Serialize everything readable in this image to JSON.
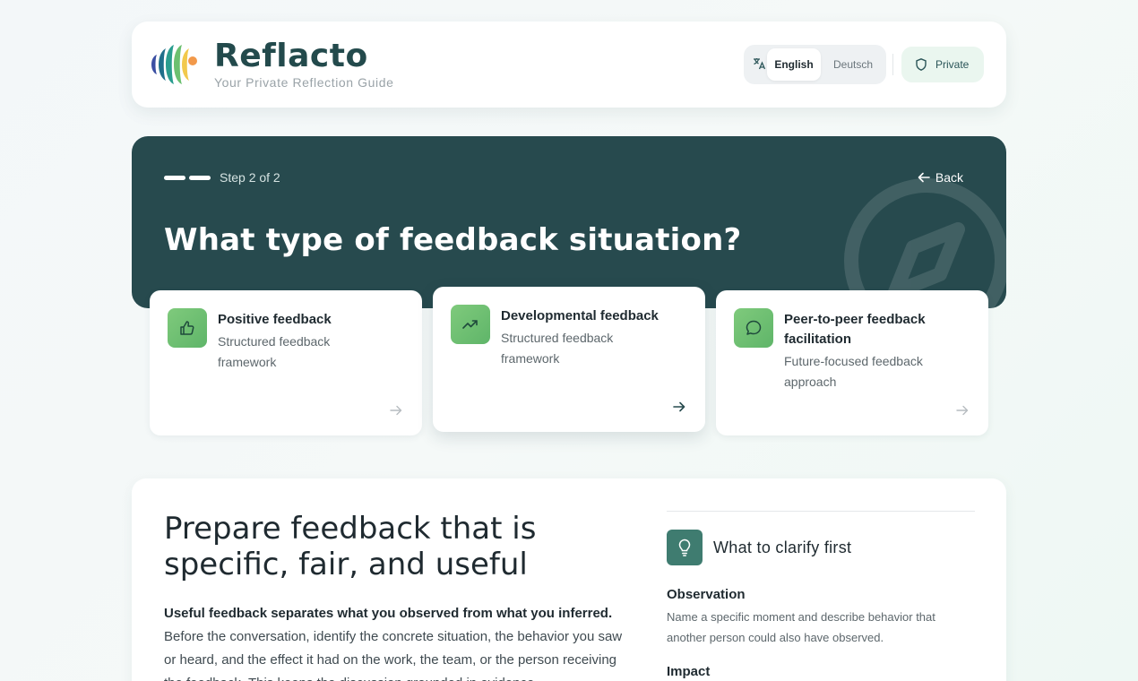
{
  "brand": {
    "name": "Reflacto",
    "tagline": "Your Private Reflection Guide"
  },
  "language": {
    "options": [
      "English",
      "Deutsch"
    ],
    "selected": "English"
  },
  "privacy": {
    "label": "Private"
  },
  "wizard": {
    "step_label": "Step 2 of 2",
    "back_label": "Back",
    "title": "What type of feedback situation?",
    "steps_total": 2,
    "steps_done": 2
  },
  "options": [
    {
      "title": "Positive feedback",
      "description": "Structured feedback framework",
      "icon": "thumbs-up-icon"
    },
    {
      "title": "Developmental feedback",
      "description": "Structured feedback framework",
      "icon": "trending-up-icon"
    },
    {
      "title": "Peer-to-peer feedback facilitation",
      "description": "Future-focused feedback approach",
      "icon": "chat-bubble-icon"
    }
  ],
  "prepare": {
    "title": "Prepare feedback that is specific, fair, and useful",
    "lead_bold": "Useful feedback separates what you observed from what you inferred.",
    "lead_text": "Before the conversation, identify the concrete situation, the behavior you saw or heard, and the effect it had on the work, the team, or the person receiving the feedback. This keeps the discussion grounded in evidence."
  },
  "clarify": {
    "title": "What to clarify first",
    "items": [
      {
        "title": "Observation",
        "description": "Name a specific moment and describe behavior that another person could also have observed."
      },
      {
        "title": "Impact",
        "description": ""
      }
    ]
  },
  "colors": {
    "hero_bg": "#274a4e",
    "accent_green": "#6cc070",
    "brand_text": "#234a4c"
  }
}
